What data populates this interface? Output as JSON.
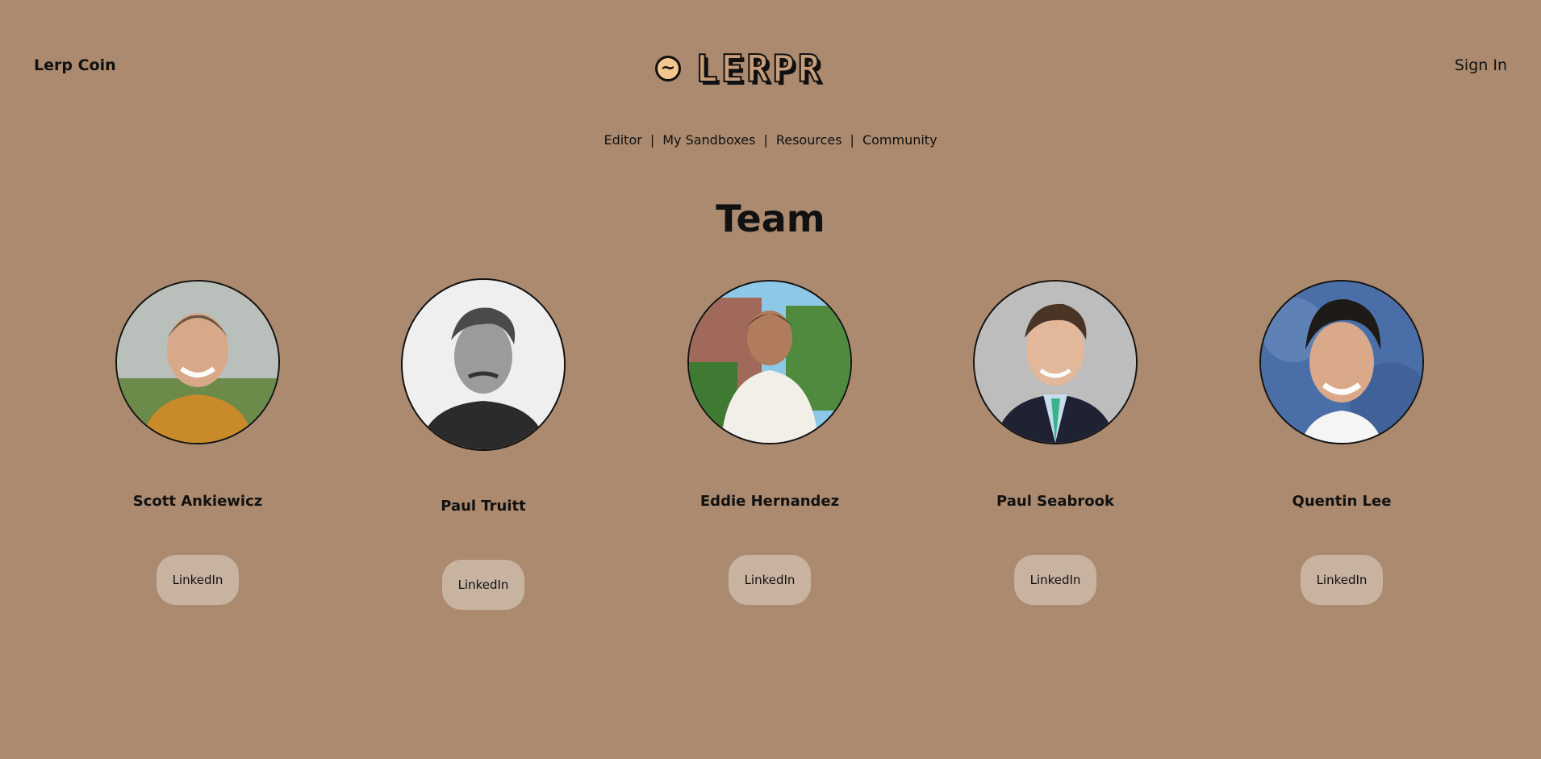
{
  "header": {
    "left_label": "Lerp Coin",
    "logo_text": "LERPR",
    "logo_icon": "wave-circle-icon",
    "sign_in_label": "Sign In"
  },
  "nav": {
    "items": [
      "Editor",
      "My Sandboxes",
      "Resources",
      "Community"
    ],
    "separator": "|"
  },
  "page": {
    "title": "Team"
  },
  "team": [
    {
      "name": "Scott Ankiewicz",
      "button": "LinkedIn"
    },
    {
      "name": "Paul Truitt",
      "button": "LinkedIn"
    },
    {
      "name": "Eddie Hernandez",
      "button": "LinkedIn"
    },
    {
      "name": "Paul Seabrook",
      "button": "LinkedIn"
    },
    {
      "name": "Quentin Lee",
      "button": "LinkedIn"
    }
  ],
  "colors": {
    "background": "#ab8a6f",
    "button": "#c8b3a1",
    "logo_icon": "#f5c78e"
  }
}
